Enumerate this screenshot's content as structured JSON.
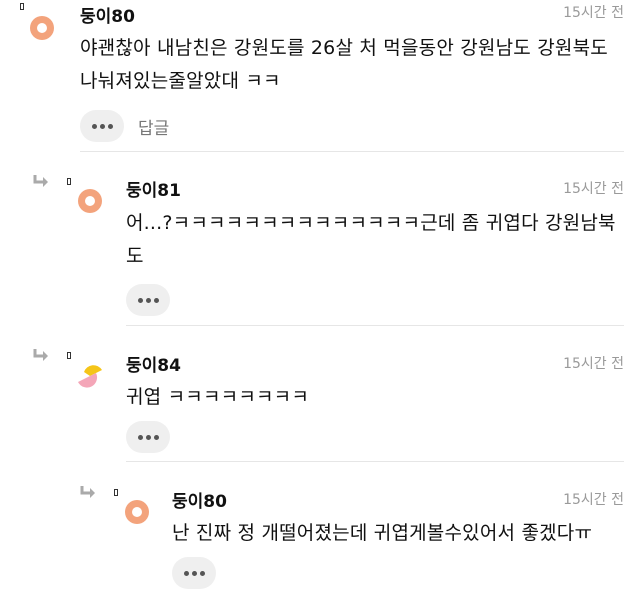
{
  "comments": [
    {
      "nickname": "둥이80",
      "time": "15시간 전",
      "text": "야괜찮아 내남친은 강원도를 26살 처 먹을동안 강원남도 강원북도 나눠져있는줄알았대 ㅋㅋ",
      "reply_label": "답글",
      "avatar_color": "#f3a37c"
    },
    {
      "nickname": "둥이81",
      "time": "15시간 전",
      "text": "어...?ㅋㅋㅋㅋㅋㅋㅋㅋㅋㅋㅋㅋㅋㅋ근데 좀 귀엽다 강원남북도",
      "avatar_color": "#f3a37c"
    },
    {
      "nickname": "둥이84",
      "time": "15시간 전",
      "text": "귀엽 ㅋㅋㅋㅋㅋㅋㅋㅋ",
      "avatar_colors": [
        "#f5c518",
        "#f4a6b8"
      ]
    },
    {
      "nickname": "둥이80",
      "time": "15시간 전",
      "text": "난 진짜 정 개떨어졌는데 귀엽게볼수있어서 좋겠다ㅠ",
      "avatar_color": "#f3a37c"
    }
  ],
  "icons": {
    "more": "more-icon",
    "reply_arrow": "reply-arrow-icon",
    "avatar": "avatar-icon"
  }
}
